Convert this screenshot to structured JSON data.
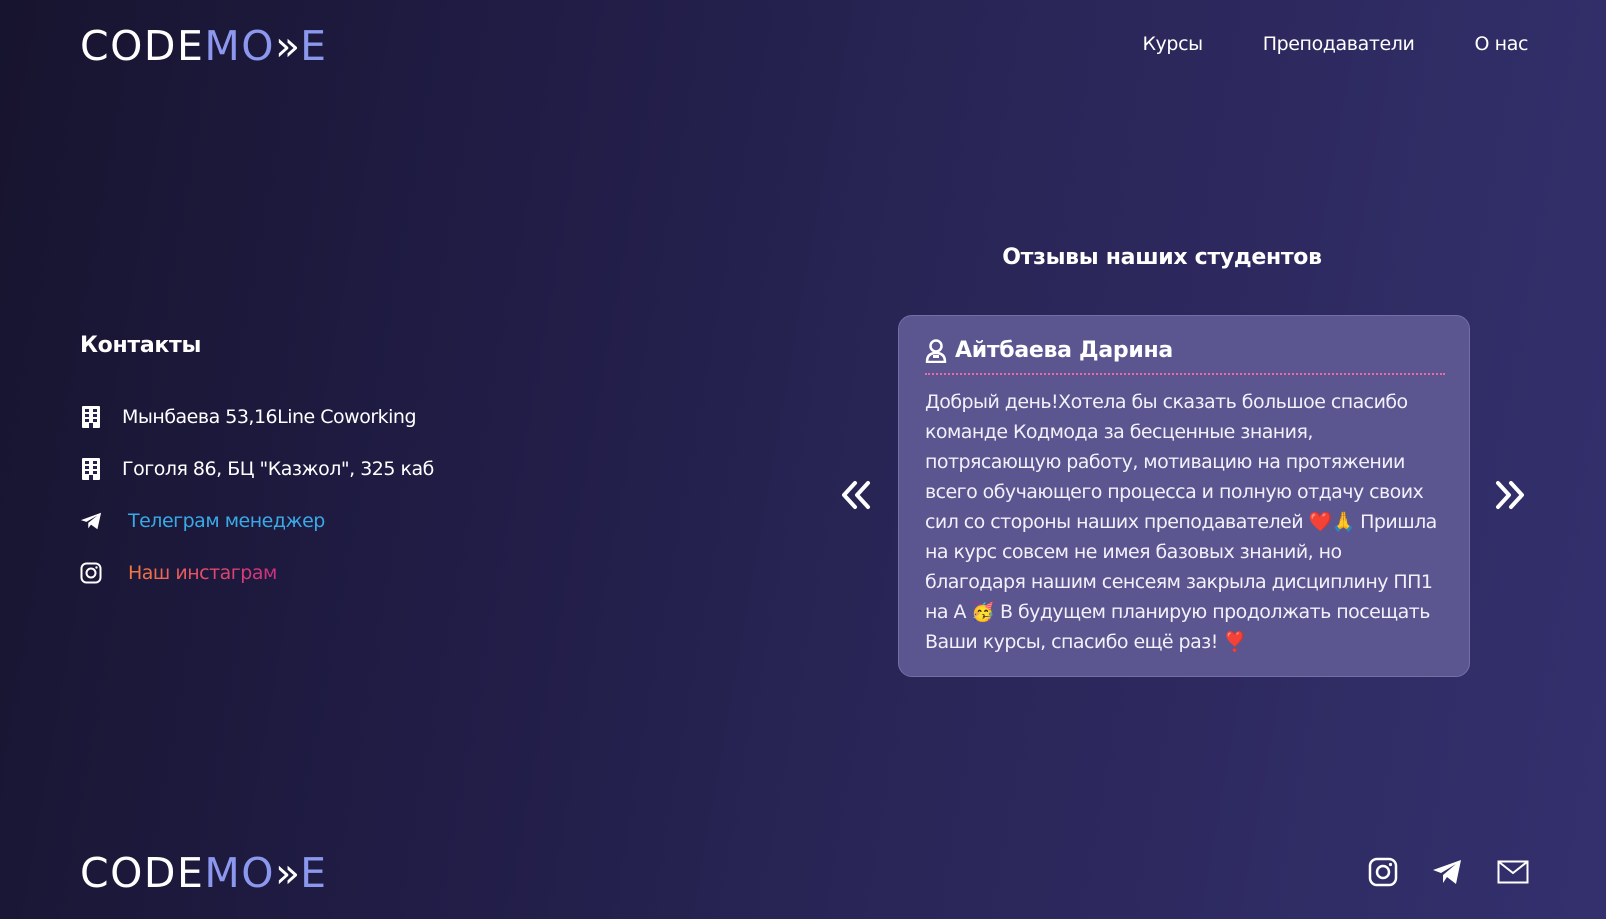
{
  "logo": {
    "part1": "CODE",
    "part2": "MO",
    "arrows": "»",
    "part3": "E"
  },
  "nav": {
    "items": [
      "Курсы",
      "Преподаватели",
      "О нас"
    ]
  },
  "contacts": {
    "title": "Контакты",
    "address1": "Мынбаева 53,16Line Coworking",
    "address2": "Гоголя 86, БЦ \"Казжол\", 325 каб",
    "telegram": "Телеграм менеджер",
    "instagram": "Наш инстаграм"
  },
  "reviews": {
    "title": "Отзывы наших студентов",
    "current": {
      "author": "Айтбаева Дарина",
      "text": "Добрый день!Хотела бы сказать большое спасибо команде Кодмода за бесценные знания, потрясающую работу, мотивацию на протяжении всего обучающего процесса и полную отдачу своих сил со стороны наших преподавателей ❤️🙏 Пришла на курс совсем не имея базовых знаний, но благодаря нашим сенсеям закрыла дисциплину ПП1 на А 🥳 В будущем планирую продолжать посещать Ваши курсы, спасибо ещё раз! ❣️"
    }
  },
  "icons": {
    "building": "building-icon",
    "telegram": "telegram-icon",
    "instagram": "instagram-icon",
    "user": "user-icon",
    "prev": "double-chevron-left-icon",
    "next": "double-chevron-right-icon",
    "mail": "mail-icon"
  },
  "colors": {
    "logo_accent": "#8b98ee",
    "telegram_link": "#3aa9e6",
    "instagram_gradient_start": "#f37b40",
    "instagram_gradient_end": "#c9307f",
    "card_bg": "#5b5590",
    "card_divider": "#e96ba8"
  }
}
